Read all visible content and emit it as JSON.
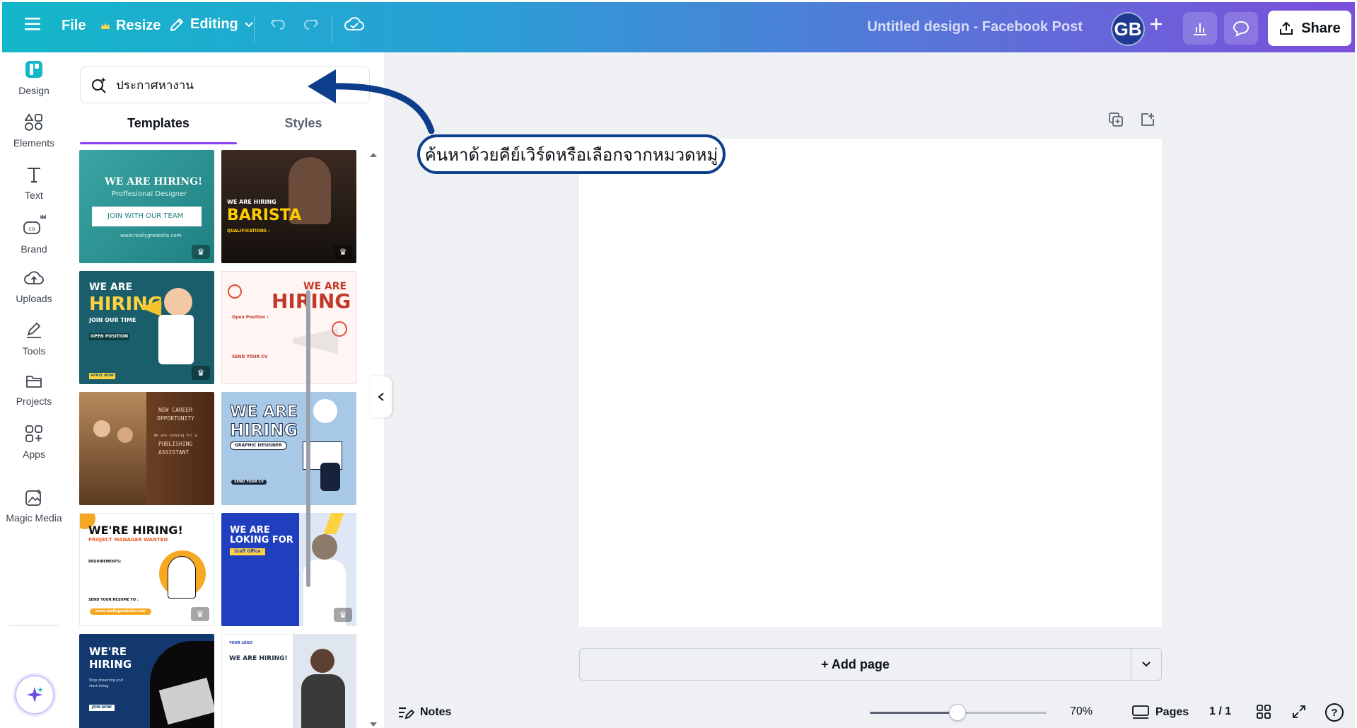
{
  "topbar": {
    "file_label": "File",
    "resize_label": "Resize",
    "editing_label": "Editing",
    "title": "Untitled design - Facebook Post",
    "avatar_initials": "GB",
    "share_label": "Share"
  },
  "rail": {
    "items": [
      {
        "label": "Design",
        "icon": "design-icon"
      },
      {
        "label": "Elements",
        "icon": "elements-icon"
      },
      {
        "label": "Text",
        "icon": "text-icon"
      },
      {
        "label": "Brand",
        "icon": "brand-icon"
      },
      {
        "label": "Uploads",
        "icon": "uploads-icon"
      },
      {
        "label": "Tools",
        "icon": "tools-icon"
      },
      {
        "label": "Projects",
        "icon": "projects-icon"
      },
      {
        "label": "Apps",
        "icon": "apps-icon"
      },
      {
        "label": "Magic Media",
        "icon": "magic-media-icon"
      }
    ]
  },
  "panel": {
    "search_value": "ประกาศหางาน",
    "tabs": [
      {
        "label": "Templates",
        "active": true
      },
      {
        "label": "Styles",
        "active": false
      }
    ],
    "templates": [
      {
        "lines": [
          "WE ARE HIRING!",
          "Proffesional Designer",
          "JOIN WITH OUR TEAM",
          "www.reallygreatsite.com"
        ]
      },
      {
        "lines": [
          "WE ARE HIRING",
          "BARISTA",
          "QUALIFICATIONS :"
        ]
      },
      {
        "lines": [
          "WE ARE",
          "HIRING",
          "JOIN OUR TIME",
          "OPEN POSITION",
          "APPLY NOW"
        ]
      },
      {
        "lines": [
          "WE ARE",
          "HIRING",
          "Open Position :",
          "SEND YOUR CV"
        ]
      },
      {
        "lines": [
          "NEW CAREER",
          "OPPORTUNITY",
          "We are looking for a",
          "PUBLISHING",
          "ASSISTANT"
        ]
      },
      {
        "lines": [
          "WE ARE",
          "HIRING",
          "GRAPHIC DESIGNER",
          "SEND YOUR CV"
        ]
      },
      {
        "lines": [
          "WE'RE HIRING!",
          "PROJECT MANAGER WANTED",
          "REQUIREMENTS:",
          "SEND YOUR RESUME TO :",
          "www.reallygreatsite.com"
        ]
      },
      {
        "lines": [
          "WE ARE",
          "LOKING FOR",
          "Staff Office"
        ]
      },
      {
        "lines": [
          "WE'RE",
          "HIRING",
          "Stop dreaming and",
          "start doing.",
          "JOIN NOW"
        ]
      },
      {
        "lines": [
          "YOUR LOGO",
          "WE ARE HIRING!"
        ]
      }
    ]
  },
  "canvas": {
    "add_page_label": "+ Add page"
  },
  "bottombar": {
    "notes_label": "Notes",
    "zoom_label": "70%",
    "zoom_value": 0.5,
    "pages_label": "Pages",
    "page_counter": "1 / 1",
    "help_label": "?"
  },
  "annotation": {
    "callout_text": "ค้นหาด้วยคีย์เวิร์ดหรือเลือกจากหมวดหมู่"
  },
  "colors": {
    "accent": "#8b3dff",
    "callout_border": "#0d3e8c",
    "avatar_bg": "#1f3a93"
  }
}
